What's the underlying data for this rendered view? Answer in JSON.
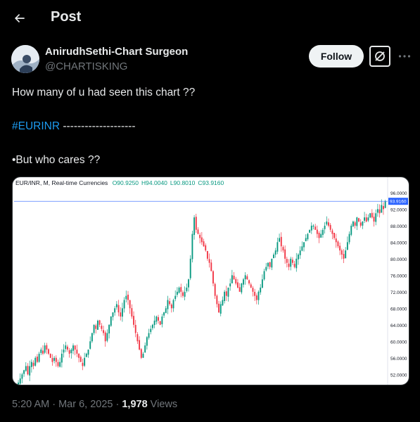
{
  "header": {
    "title": "Post"
  },
  "author": {
    "name": "AnirudhSethi-Chart Surgeon",
    "handle": "@CHARTISKING"
  },
  "actions": {
    "follow_label": "Follow"
  },
  "post": {
    "line1": "How many of u had seen this chart ??",
    "hashtag": "#EURINR",
    "dashes": " --------------------",
    "line3": "•But who cares ??"
  },
  "chart_data": {
    "type": "candlestick",
    "symbol_label": "EUR/INR, M, Real-time Currencies",
    "ohlc": {
      "open": "O90.9250",
      "high": "H94.0040",
      "low": "L90.8010",
      "close": "C93.9160"
    },
    "last_price_label": "93.9160",
    "y_tick_labels": [
      "96.0000",
      "92.0000",
      "88.0000",
      "84.0000",
      "80.0000",
      "76.0000",
      "72.0000",
      "68.0000",
      "64.0000",
      "60.0000",
      "56.0000",
      "52.0000"
    ],
    "ylim": [
      50,
      97
    ],
    "colors": {
      "up": "#089981",
      "down": "#f23645",
      "price_line": "#2962ff"
    },
    "close_series": [
      49,
      50,
      51,
      52,
      53,
      54,
      52,
      54,
      55,
      54,
      56,
      55,
      57,
      58,
      57,
      59,
      58,
      57,
      56,
      55,
      56,
      55,
      54,
      55,
      57,
      58,
      59,
      58,
      57,
      58,
      59,
      58,
      57,
      56,
      55,
      54,
      56,
      57,
      58,
      60,
      62,
      64,
      63,
      65,
      64,
      63,
      62,
      60,
      62,
      64,
      66,
      67,
      68,
      69,
      67,
      66,
      68,
      70,
      71,
      70,
      68,
      66,
      64,
      62,
      60,
      58,
      56,
      57,
      59,
      61,
      62,
      63,
      64,
      65,
      66,
      65,
      64,
      66,
      67,
      68,
      70,
      69,
      68,
      70,
      71,
      72,
      73,
      72,
      71,
      72,
      73,
      75,
      80,
      86,
      90,
      87,
      86,
      85,
      84,
      83,
      82,
      80,
      79,
      77,
      74,
      71,
      69,
      67,
      69,
      70,
      72,
      71,
      73,
      74,
      76,
      75,
      74,
      73,
      72,
      74,
      75,
      76,
      75,
      74,
      73,
      72,
      71,
      70,
      72,
      73,
      75,
      77,
      78,
      79,
      78,
      80,
      81,
      82,
      84,
      85,
      83,
      82,
      80,
      79,
      78,
      80,
      79,
      78,
      80,
      81,
      82,
      83,
      84,
      85,
      86,
      87,
      88,
      88,
      87,
      86,
      85,
      86,
      87,
      88,
      89,
      88,
      87,
      86,
      85,
      84,
      83,
      82,
      81,
      80,
      82,
      84,
      86,
      88,
      89,
      88,
      90,
      89,
      88,
      89,
      90,
      89,
      90,
      91,
      90,
      89,
      91,
      92,
      91,
      93,
      92,
      93.9
    ]
  },
  "meta": {
    "time": "5:20 AM · Mar 6, 2025 · ",
    "views_count": "1,978",
    "views_label": " Views"
  }
}
